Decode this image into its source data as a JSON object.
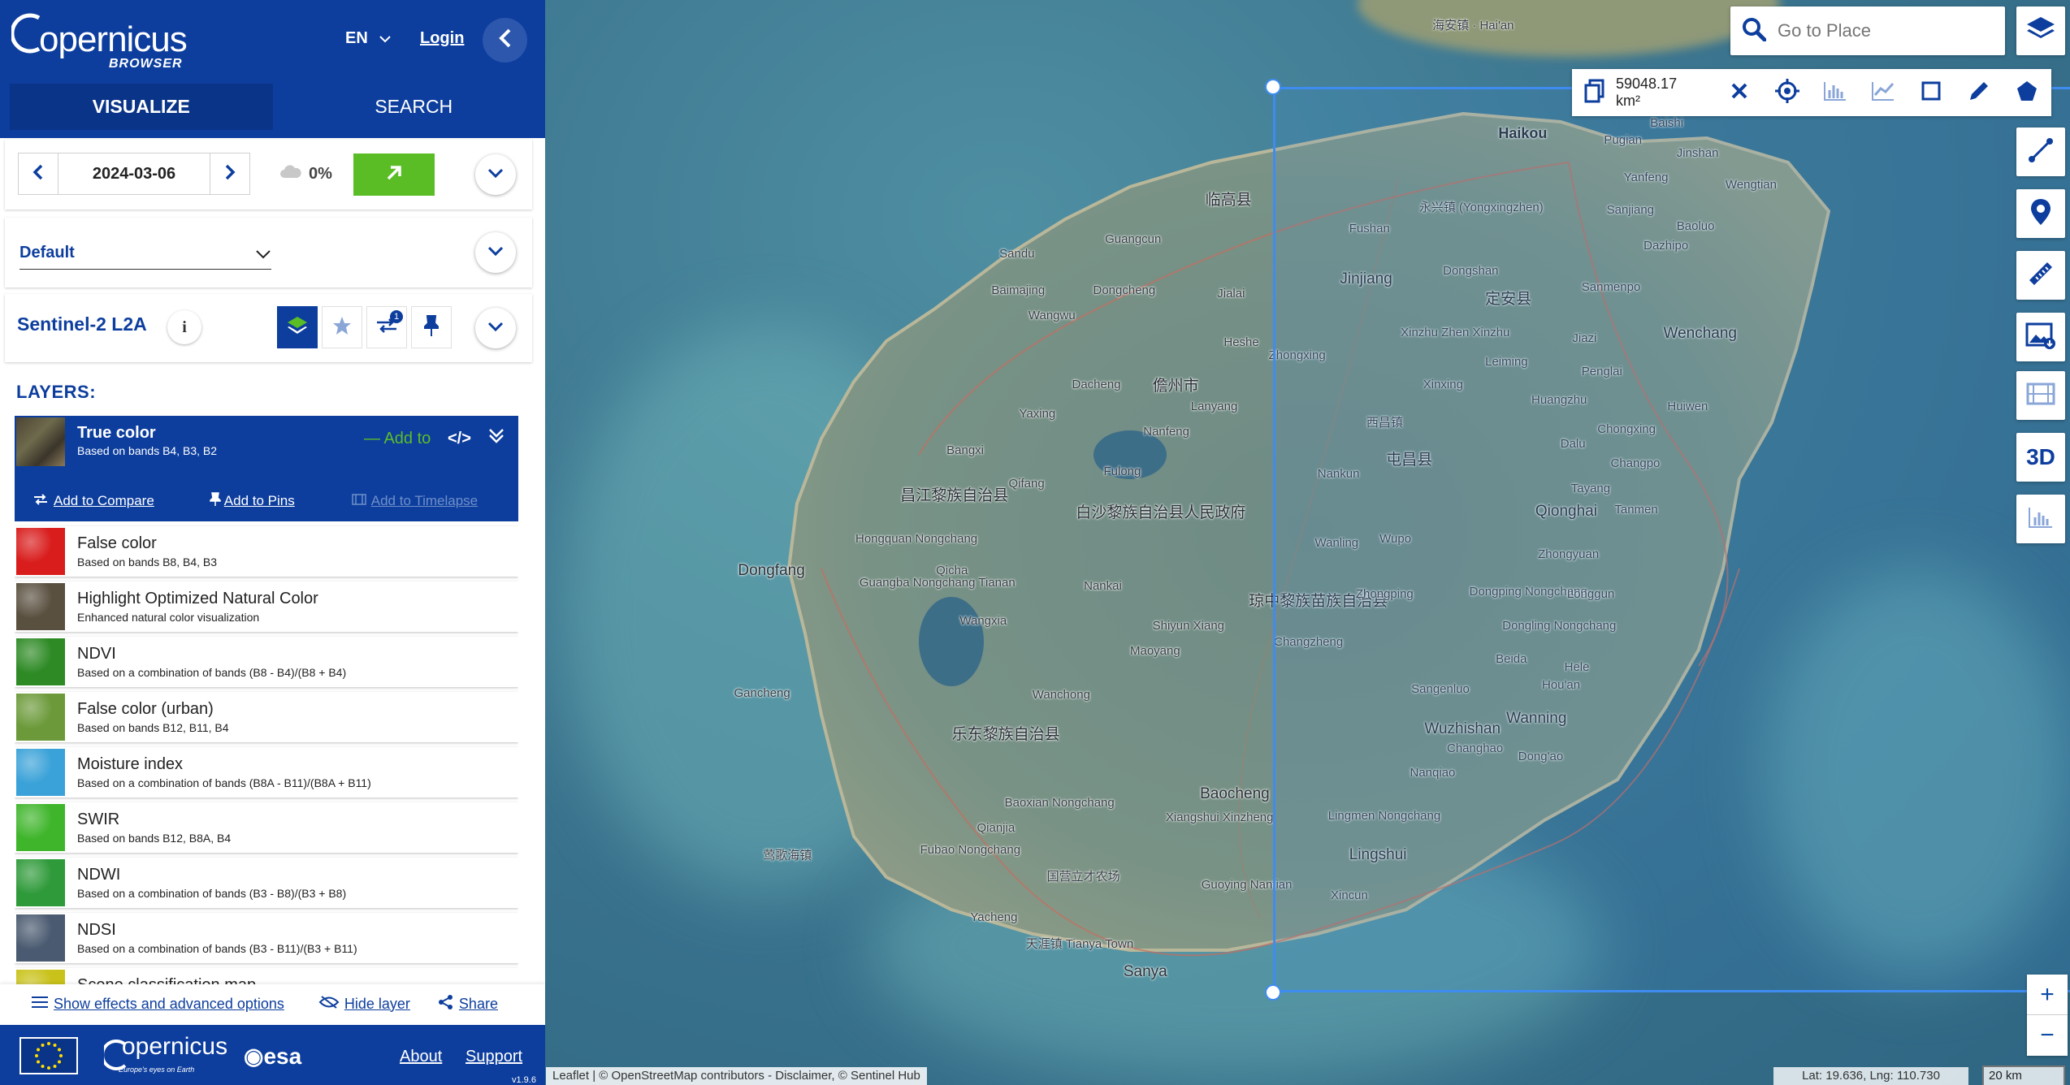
{
  "header": {
    "logo_text": "opernicus",
    "logo_sub": "BROWSER",
    "language": "EN",
    "login": "Login"
  },
  "tabs": [
    {
      "label": "VISUALIZE",
      "active": true
    },
    {
      "label": "SEARCH",
      "active": false
    }
  ],
  "date_row": {
    "date": "2024-03-06",
    "cloud_coverage": "0%"
  },
  "theme": {
    "selected": "Default"
  },
  "dataset": {
    "name": "Sentinel-2 L2A",
    "info_icon": "i",
    "filter_badge": "1"
  },
  "layers_title": "LAYERS:",
  "active_layer": {
    "title": "True color",
    "description": "Based on bands B4, B3, B2",
    "add_to": "Add to",
    "code_icon": "</>",
    "add_to_compare": "Add to Compare",
    "add_to_pins": "Add to Pins",
    "add_to_timelapse": "Add to Timelapse"
  },
  "layers": [
    {
      "title": "False color",
      "description": "Based on bands B8, B4, B3",
      "thumb_color": "#d91c1c"
    },
    {
      "title": "Highlight Optimized Natural Color",
      "description": "Enhanced natural color visualization",
      "thumb_color": "#5a5040"
    },
    {
      "title": "NDVI",
      "description": "Based on a combination of bands (B8 - B4)/(B8 + B4)",
      "thumb_color": "#2e8a25"
    },
    {
      "title": "False color (urban)",
      "description": "Based on bands B12, B11, B4",
      "thumb_color": "#6c9a3a"
    },
    {
      "title": "Moisture index",
      "description": "Based on a combination of bands (B8A - B11)/(B8A + B11)",
      "thumb_color": "#3aa2d8"
    },
    {
      "title": "SWIR",
      "description": "Based on bands B12, B8A, B4",
      "thumb_color": "#3fb52b"
    },
    {
      "title": "NDWI",
      "description": "Based on a combination of bands (B3 - B8)/(B3 + B8)",
      "thumb_color": "#2f9a3a"
    },
    {
      "title": "NDSI",
      "description": "Based on a combination of bands (B3 - B11)/(B3 + B11)",
      "thumb_color": "#4a5a70"
    },
    {
      "title": "Scene classification map",
      "description": "",
      "thumb_color": "#c9c21a"
    }
  ],
  "bottom_links": {
    "effects": "Show effects and advanced options",
    "hide_layer": "Hide layer",
    "share": "Share"
  },
  "footer": {
    "copernicus": "opernicus",
    "copernicus_sub": "Europe's eyes on Earth",
    "esa": "esa",
    "about": "About",
    "support": "Support",
    "version": "v1.9.6"
  },
  "map": {
    "search_placeholder": "Go to Place",
    "aoi_area": "59048.17 km²",
    "attribution": "Leaflet | © OpenStreetMap contributors - Disclaimer, © Sentinel Hub",
    "coordinates": "Lat: 19.636, Lng: 110.730",
    "scale": "20 km",
    "zoom_in": "+",
    "zoom_out": "−",
    "btn_3d": "3D",
    "places": [
      {
        "name": "海安镇 · Hai'an",
        "cls": ""
      },
      {
        "name": "Haikou",
        "cls": "city"
      },
      {
        "name": "Pugian",
        "cls": ""
      },
      {
        "name": "Baishi",
        "cls": ""
      },
      {
        "name": "Jinshan",
        "cls": ""
      },
      {
        "name": "Yanfeng",
        "cls": ""
      },
      {
        "name": "Wengtian",
        "cls": ""
      },
      {
        "name": "临高县",
        "cls": "big"
      },
      {
        "name": "永兴镇 (Yongxingzhen)",
        "cls": ""
      },
      {
        "name": "Sanjiang",
        "cls": ""
      },
      {
        "name": "Baoluo",
        "cls": ""
      },
      {
        "name": "Dazhipo",
        "cls": ""
      },
      {
        "name": "Guangcun",
        "cls": ""
      },
      {
        "name": "Fushan",
        "cls": ""
      },
      {
        "name": "Sandu",
        "cls": ""
      },
      {
        "name": "Jinjiang",
        "cls": "big"
      },
      {
        "name": "Dongshan",
        "cls": ""
      },
      {
        "name": "定安县",
        "cls": "big"
      },
      {
        "name": "Sanmenpo",
        "cls": ""
      },
      {
        "name": "Baimajing",
        "cls": ""
      },
      {
        "name": "Dongcheng",
        "cls": ""
      },
      {
        "name": "Jialai",
        "cls": ""
      },
      {
        "name": "Wangwu",
        "cls": ""
      },
      {
        "name": "Xinzhu Zhen Xinzhu",
        "cls": ""
      },
      {
        "name": "Jiazi",
        "cls": ""
      },
      {
        "name": "Wenchang",
        "cls": "big"
      },
      {
        "name": "Heshe",
        "cls": ""
      },
      {
        "name": "Zhongxing",
        "cls": ""
      },
      {
        "name": "Leiming",
        "cls": ""
      },
      {
        "name": "Penglai",
        "cls": ""
      },
      {
        "name": "Dacheng",
        "cls": ""
      },
      {
        "name": "儋州市",
        "cls": "big"
      },
      {
        "name": "Xinxing",
        "cls": ""
      },
      {
        "name": "Huangzhu",
        "cls": ""
      },
      {
        "name": "Lanyang",
        "cls": ""
      },
      {
        "name": "Huiwen",
        "cls": ""
      },
      {
        "name": "Yaxing",
        "cls": ""
      },
      {
        "name": "西昌镇",
        "cls": ""
      },
      {
        "name": "Nanfeng",
        "cls": ""
      },
      {
        "name": "Chongxing",
        "cls": ""
      },
      {
        "name": "Dalu",
        "cls": ""
      },
      {
        "name": "Bangxi",
        "cls": ""
      },
      {
        "name": "屯昌县",
        "cls": "big"
      },
      {
        "name": "Changpo",
        "cls": ""
      },
      {
        "name": "Fulong",
        "cls": ""
      },
      {
        "name": "Nankun",
        "cls": ""
      },
      {
        "name": "昌江黎族自治县",
        "cls": "big"
      },
      {
        "name": "Qifang",
        "cls": ""
      },
      {
        "name": "Tayang",
        "cls": ""
      },
      {
        "name": "白沙黎族自治县人民政府",
        "cls": "big"
      },
      {
        "name": "Qionghai",
        "cls": "big"
      },
      {
        "name": "Tanmen",
        "cls": ""
      },
      {
        "name": "Hongquan Nongchang",
        "cls": ""
      },
      {
        "name": "Wanling",
        "cls": ""
      },
      {
        "name": "Wupo",
        "cls": ""
      },
      {
        "name": "Dongfang",
        "cls": "big"
      },
      {
        "name": "Qicha",
        "cls": ""
      },
      {
        "name": "Zhongyuan",
        "cls": ""
      },
      {
        "name": "Guangba Nongchang Tianan",
        "cls": ""
      },
      {
        "name": "Nankai",
        "cls": ""
      },
      {
        "name": "琼中黎族苗族自治县",
        "cls": "big"
      },
      {
        "name": "Zhongping",
        "cls": ""
      },
      {
        "name": "Dongping Nongchang",
        "cls": ""
      },
      {
        "name": "Longgun",
        "cls": ""
      },
      {
        "name": "Wangxia",
        "cls": ""
      },
      {
        "name": "Shiyun Xiang",
        "cls": ""
      },
      {
        "name": "Changzheng",
        "cls": ""
      },
      {
        "name": "Dongling Nongchang",
        "cls": ""
      },
      {
        "name": "Maoyang",
        "cls": ""
      },
      {
        "name": "Beida",
        "cls": ""
      },
      {
        "name": "Gancheng",
        "cls": ""
      },
      {
        "name": "Wanchong",
        "cls": ""
      },
      {
        "name": "Sangenluo",
        "cls": ""
      },
      {
        "name": "Hele",
        "cls": ""
      },
      {
        "name": "Hou'an",
        "cls": ""
      },
      {
        "name": "乐东黎族自治县",
        "cls": "big"
      },
      {
        "name": "Wuzhishan",
        "cls": "big"
      },
      {
        "name": "Changhao",
        "cls": ""
      },
      {
        "name": "Wanning",
        "cls": "big"
      },
      {
        "name": "Dong'ao",
        "cls": ""
      },
      {
        "name": "Nanqiao",
        "cls": ""
      },
      {
        "name": "Baocheng",
        "cls": "big"
      },
      {
        "name": "Baoxian Nongchang",
        "cls": ""
      },
      {
        "name": "Lingmen Nongchang",
        "cls": ""
      },
      {
        "name": "Qianjia",
        "cls": ""
      },
      {
        "name": "Xiangshui Xinzheng",
        "cls": ""
      },
      {
        "name": "Fubao Nongchang",
        "cls": ""
      },
      {
        "name": "莺歌海镇",
        "cls": ""
      },
      {
        "name": "Lingshui",
        "cls": "big"
      },
      {
        "name": "国营立才农场",
        "cls": ""
      },
      {
        "name": "Guoying Nantian",
        "cls": ""
      },
      {
        "name": "Xincun",
        "cls": ""
      },
      {
        "name": "Yacheng",
        "cls": ""
      },
      {
        "name": "天涯镇 Tianya Town",
        "cls": ""
      },
      {
        "name": "Sanya",
        "cls": "big"
      }
    ]
  }
}
